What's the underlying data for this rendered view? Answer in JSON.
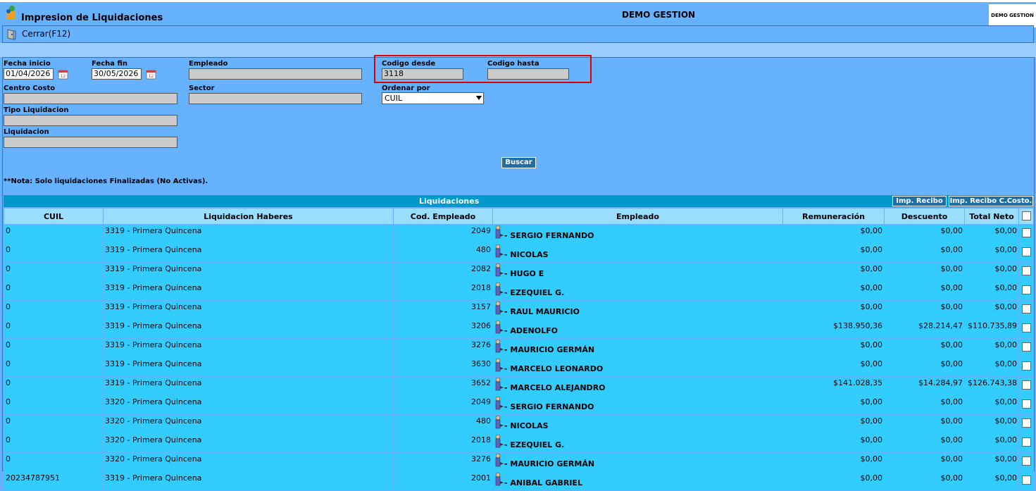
{
  "window": {
    "title": "Impresion de Liquidaciones",
    "company": "DEMO GESTION",
    "company_logo_text": "DEMO GESTION"
  },
  "toolbar": {
    "close_label": "Cerrar(F12)"
  },
  "filters": {
    "fecha_inicio": {
      "label": "Fecha inicio",
      "value": "01/04/2026"
    },
    "fecha_fin": {
      "label": "Fecha fin",
      "value": "30/05/2026"
    },
    "empleado": {
      "label": "Empleado",
      "value": ""
    },
    "codigo_desde": {
      "label": "Codigo desde",
      "value": "3118"
    },
    "codigo_hasta": {
      "label": "Codigo hasta",
      "value": ""
    },
    "centro_costo": {
      "label": "Centro Costo",
      "value": ""
    },
    "sector": {
      "label": "Sector",
      "value": ""
    },
    "ordenar_por": {
      "label": "Ordenar por",
      "value": "CUIL"
    },
    "tipo_liquidacion": {
      "label": "Tipo Liquidacion",
      "value": ""
    },
    "liquidacion": {
      "label": "Liquidacion",
      "value": ""
    }
  },
  "search_label": "Buscar",
  "note": "**Nota: Solo liquidaciones Finalizadas (No Activas).",
  "grid": {
    "title": "Liquidaciones",
    "btn_recibo": "Imp. Recibo",
    "btn_recibo_cc": "Imp. Recibo C.Costo.",
    "columns": [
      "CUIL",
      "Liquidacion Haberes",
      "Cod. Empleado",
      "Empleado",
      "Remuneración",
      "Descuento",
      "Total Neto"
    ],
    "rows": [
      {
        "cuil": "0",
        "liq": "3319 - Primera Quincena",
        "cod": "2049",
        "emp": "- SERGIO FERNANDO",
        "rem": "$0,00",
        "desc": "$0,00",
        "neto": "$0,00"
      },
      {
        "cuil": "0",
        "liq": "3319 - Primera Quincena",
        "cod": "480",
        "emp": "- NICOLAS",
        "rem": "$0,00",
        "desc": "$0,00",
        "neto": "$0,00"
      },
      {
        "cuil": "0",
        "liq": "3319 - Primera Quincena",
        "cod": "2082",
        "emp": "- HUGO E",
        "rem": "$0,00",
        "desc": "$0,00",
        "neto": "$0,00"
      },
      {
        "cuil": "0",
        "liq": "3319 - Primera Quincena",
        "cod": "2018",
        "emp": "- EZEQUIEL G.",
        "rem": "$0,00",
        "desc": "$0,00",
        "neto": "$0,00"
      },
      {
        "cuil": "0",
        "liq": "3319 - Primera Quincena",
        "cod": "3157",
        "emp": "- RAUL MAURICIO",
        "rem": "$0,00",
        "desc": "$0,00",
        "neto": "$0,00"
      },
      {
        "cuil": "0",
        "liq": "3319 - Primera Quincena",
        "cod": "3206",
        "emp": "- ADENOLFO",
        "rem": "$138.950,36",
        "desc": "$28.214,47",
        "neto": "$110.735,89"
      },
      {
        "cuil": "0",
        "liq": "3319 - Primera Quincena",
        "cod": "3276",
        "emp": "- MAURICIO GERMÁN",
        "rem": "$0,00",
        "desc": "$0,00",
        "neto": "$0,00"
      },
      {
        "cuil": "0",
        "liq": "3319 - Primera Quincena",
        "cod": "3630",
        "emp": "- MARCELO LEONARDO",
        "rem": "$0,00",
        "desc": "$0,00",
        "neto": "$0,00"
      },
      {
        "cuil": "0",
        "liq": "3319 - Primera Quincena",
        "cod": "3652",
        "emp": "- MARCELO ALEJANDRO",
        "rem": "$141.028,35",
        "desc": "$14.284,97",
        "neto": "$126.743,38"
      },
      {
        "cuil": "0",
        "liq": "3320 - Primera Quincena",
        "cod": "2049",
        "emp": "- SERGIO FERNANDO",
        "rem": "$0,00",
        "desc": "$0,00",
        "neto": "$0,00"
      },
      {
        "cuil": "0",
        "liq": "3320 - Primera Quincena",
        "cod": "480",
        "emp": "- NICOLAS",
        "rem": "$0,00",
        "desc": "$0,00",
        "neto": "$0,00"
      },
      {
        "cuil": "0",
        "liq": "3320 - Primera Quincena",
        "cod": "2018",
        "emp": "- EZEQUIEL G.",
        "rem": "$0,00",
        "desc": "$0,00",
        "neto": "$0,00"
      },
      {
        "cuil": "0",
        "liq": "3320 - Primera Quincena",
        "cod": "3276",
        "emp": "- MAURICIO GERMÁN",
        "rem": "$0,00",
        "desc": "$0,00",
        "neto": "$0,00"
      },
      {
        "cuil": "20234787951",
        "liq": "3319 - Primera Quincena",
        "cod": "2001",
        "emp": "- ANIBAL GABRIEL",
        "rem": "$0,00",
        "desc": "$0,00",
        "neto": "$0,00"
      }
    ]
  }
}
